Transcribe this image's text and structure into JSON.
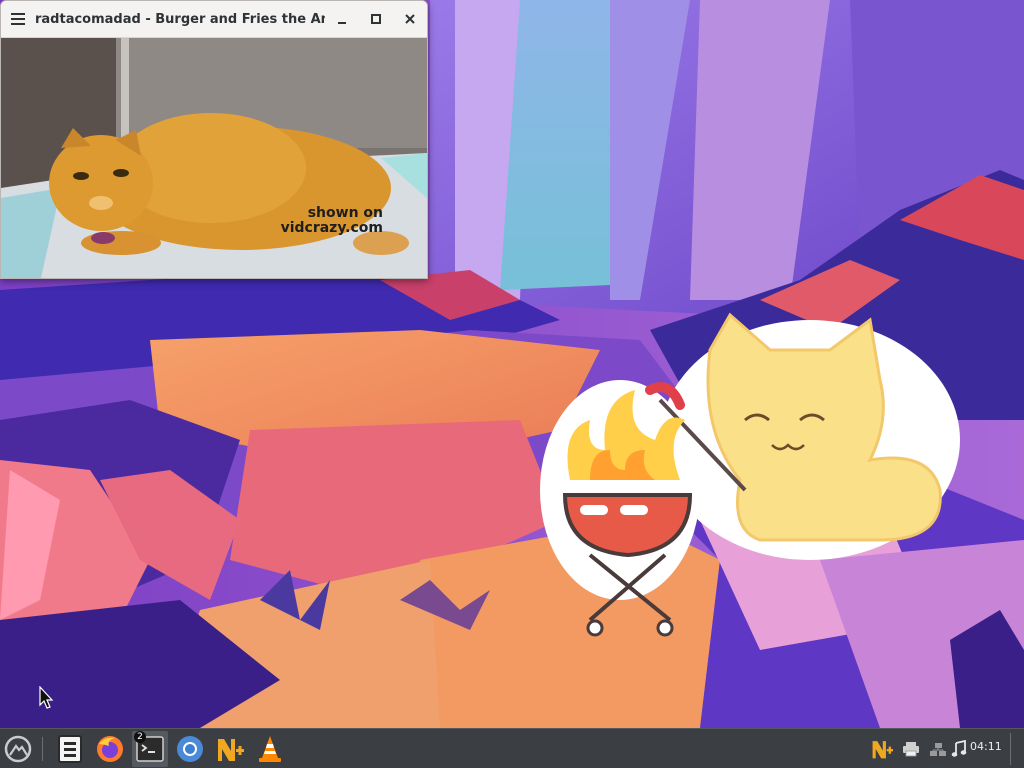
{
  "window": {
    "title": "radtacomadad - Burger and Fries the Angr",
    "menu_icon": "hamburger-menu-icon",
    "minimize_icon": "minimize-icon",
    "maximize_icon": "maximize-icon",
    "close_icon": "close-icon"
  },
  "video": {
    "watermark_line1": "shown on",
    "watermark_line2": "vidcrazy.com"
  },
  "taskbar": {
    "launchers": [
      {
        "name": "start-menu",
        "icon": "mountain-logo-icon"
      },
      {
        "name": "file-manager",
        "icon": "file-cabinet-icon"
      },
      {
        "name": "firefox",
        "icon": "firefox-icon"
      },
      {
        "name": "terminal",
        "icon": "terminal-icon"
      },
      {
        "name": "chromium",
        "icon": "chromium-icon"
      },
      {
        "name": "notes-app",
        "icon": "n-plus-icon"
      },
      {
        "name": "vlc",
        "icon": "vlc-cone-icon"
      }
    ],
    "terminal_badge": "2",
    "tray": [
      "n-plus-icon",
      "printer-icon",
      "network-icon",
      "music-note-icon"
    ],
    "clock": "04:11"
  },
  "colors": {
    "taskbar_bg": "#3b3f44",
    "title_bar_bg": "#f4f3f2",
    "wallpaper_purple": "#4b2fa6",
    "wallpaper_orange": "#f0915a"
  }
}
